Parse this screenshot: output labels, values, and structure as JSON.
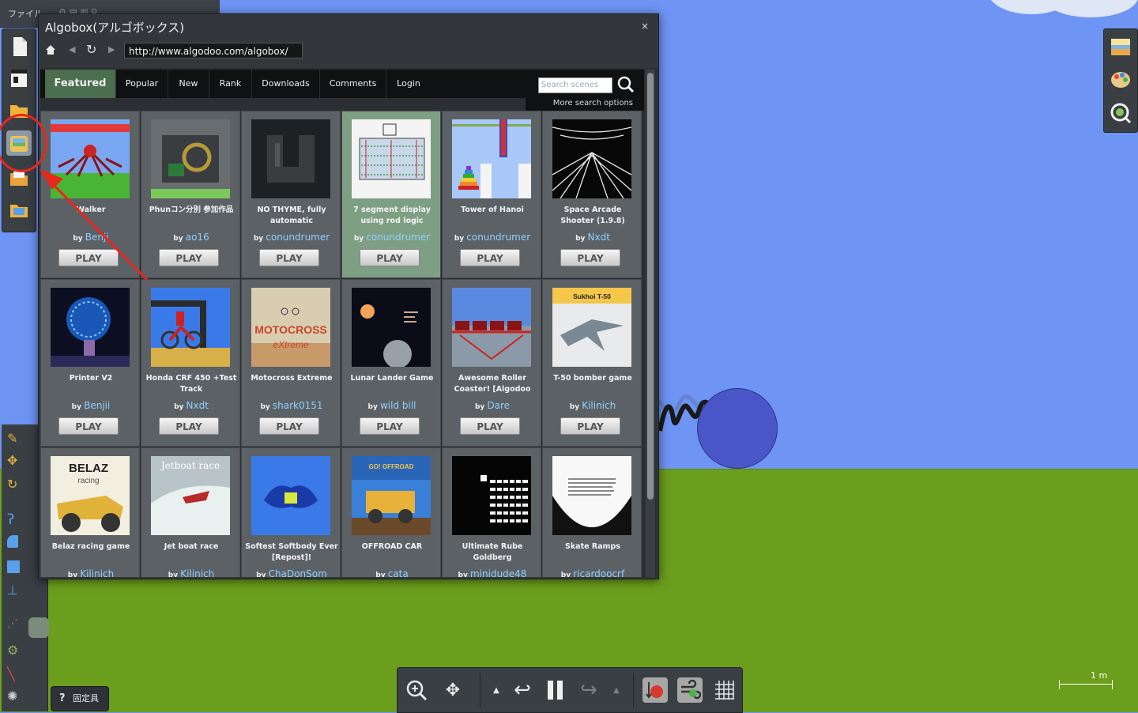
{
  "app": {
    "menu_label": "ファイル"
  },
  "dialog": {
    "title": "Algobox(アルゴボックス)",
    "close_symbol": "×",
    "url": "http://www.algodoo.com/algobox/"
  },
  "tabs": [
    {
      "label": "Featured",
      "active": true
    },
    {
      "label": "Popular"
    },
    {
      "label": "New"
    },
    {
      "label": "Rank"
    },
    {
      "label": "Downloads"
    },
    {
      "label": "Comments"
    },
    {
      "label": "Login"
    }
  ],
  "search": {
    "placeholder": "Search scenes",
    "more_options": "More search options"
  },
  "by_label": "by",
  "play_label": "PLAY",
  "scenes": [
    {
      "title": "Walker",
      "author": "Benji",
      "thumb": "walker"
    },
    {
      "title": "Phunコン分別 参加作品",
      "author": "ao16",
      "thumb": "phun"
    },
    {
      "title": "NO THYME, fully automatic",
      "author": "conundrumer",
      "thumb": "thyme"
    },
    {
      "title": "7 segment display using rod logic",
      "author": "conundrumer",
      "thumb": "segment",
      "highlight": true
    },
    {
      "title": "Tower of Hanoi",
      "author": "conundrumer",
      "thumb": "hanoi"
    },
    {
      "title": "Space Arcade Shooter (1.9.8)",
      "author": "Nxdt",
      "thumb": "space"
    },
    {
      "title": "Printer V2",
      "author": "Benjii",
      "thumb": "printer"
    },
    {
      "title": "Honda CRF 450 +Test Track",
      "author": "Nxdt",
      "thumb": "honda"
    },
    {
      "title": "Motocross Extreme",
      "author": "shark0151",
      "thumb": "motocross"
    },
    {
      "title": "Lunar Lander Game",
      "author": "wild bill",
      "thumb": "lunar"
    },
    {
      "title": "Awesome Roller Coaster! [Algodoo",
      "author": "Dare",
      "thumb": "coaster"
    },
    {
      "title": "T-50 bomber game",
      "author": "Kilinich",
      "thumb": "t50"
    },
    {
      "title": "Belaz racing game",
      "author": "Kilinich",
      "thumb": "belaz"
    },
    {
      "title": "Jet boat race",
      "author": "Kilinich",
      "thumb": "jetboat"
    },
    {
      "title": "Softest Softbody Ever [Repost]!",
      "author": "ChaDonSom",
      "thumb": "softbody"
    },
    {
      "title": "OFFROAD CAR",
      "author": "cata",
      "thumb": "offroad"
    },
    {
      "title": "Ultimate Rube Goldberg",
      "author": "minidude48",
      "thumb": "rube"
    },
    {
      "title": "Skate Ramps",
      "author": "ricardoocrf",
      "thumb": "skate"
    }
  ],
  "thumb_text": {
    "motocross": "MOTOCROSS eXtreme",
    "t50": "Sukhoi T-50",
    "belaz_big": "BELAZ",
    "belaz_small": "racing",
    "jetboat": "Jetboat race",
    "offroad": "GO! OFFROAD"
  },
  "help_button": {
    "icon": "?",
    "label": "固定具"
  },
  "scale_label": "1 m",
  "colors": {
    "sky": "#6e94f4",
    "ground": "#6b9e1c",
    "featured_tab": "#4a6e4e",
    "author_link": "#8fd0ff",
    "annotation": "#e8261c"
  },
  "icons": {
    "home": "home-icon",
    "back": "back-icon",
    "reload": "reload-icon",
    "forward": "forward-icon",
    "search": "search-icon",
    "zoom": "zoom-icon",
    "move": "move-icon",
    "undo": "undo-icon",
    "pause": "pause-icon",
    "redo": "redo-icon",
    "gravity": "gravity-icon",
    "air": "air-resistance-icon",
    "grid": "grid-icon"
  }
}
